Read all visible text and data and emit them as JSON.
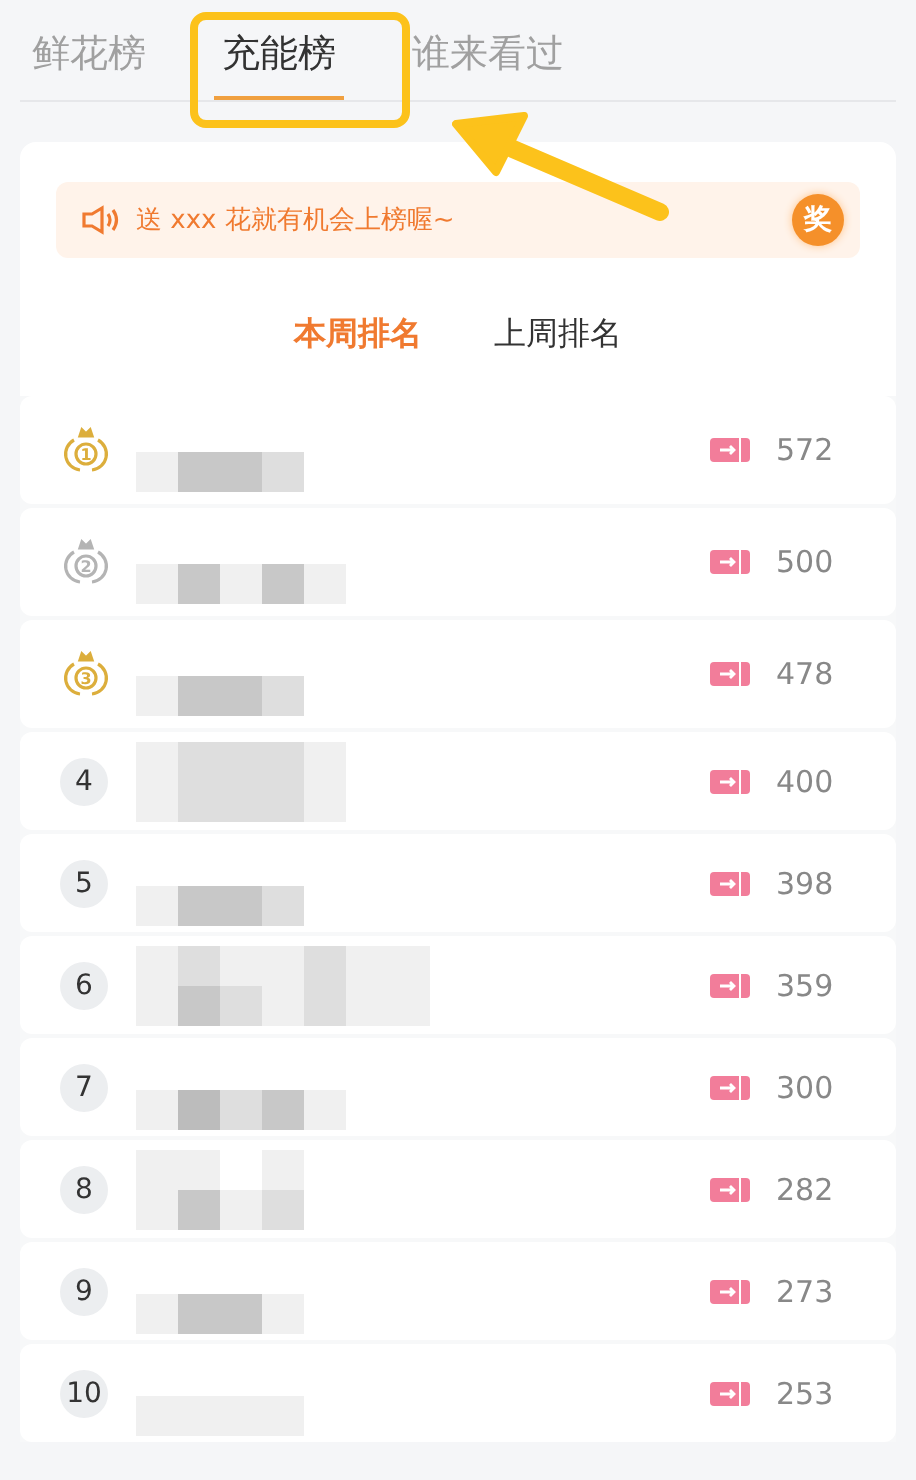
{
  "tabs": [
    {
      "label": "鲜花榜",
      "selected": false
    },
    {
      "label": "充能榜",
      "selected": true
    },
    {
      "label": "谁来看过",
      "selected": false
    }
  ],
  "banner": {
    "text": "送 xxx 花就有机会上榜喔~",
    "badge": "奖"
  },
  "period_tabs": [
    {
      "label": "本周排名",
      "selected": true
    },
    {
      "label": "上周排名",
      "selected": false
    }
  ],
  "rows": [
    {
      "kind": "medal",
      "rank": "1",
      "color": "#dcae3c",
      "score": "572"
    },
    {
      "kind": "medal",
      "rank": "2",
      "color": "#b4b4b4",
      "score": "500"
    },
    {
      "kind": "medal",
      "rank": "3",
      "color": "#dcae3c",
      "score": "478"
    },
    {
      "kind": "number",
      "rank": "4",
      "score": "400"
    },
    {
      "kind": "number",
      "rank": "5",
      "score": "398"
    },
    {
      "kind": "number",
      "rank": "6",
      "score": "359"
    },
    {
      "kind": "number",
      "rank": "7",
      "score": "300"
    },
    {
      "kind": "number",
      "rank": "8",
      "score": "282"
    },
    {
      "kind": "number",
      "rank": "9",
      "score": "273"
    },
    {
      "kind": "number",
      "rank": "10",
      "score": "253"
    }
  ]
}
